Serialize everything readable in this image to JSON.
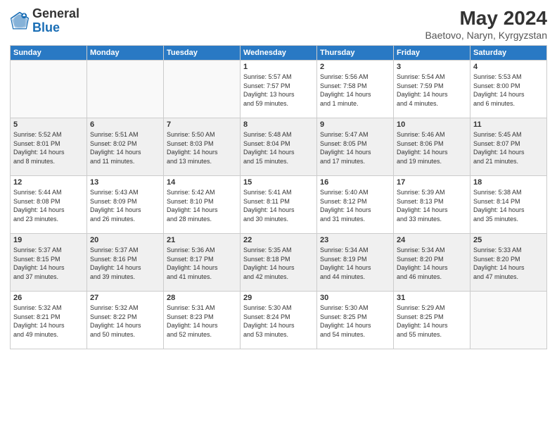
{
  "logo": {
    "text_general": "General",
    "text_blue": "Blue"
  },
  "header": {
    "month": "May 2024",
    "location": "Baetovo, Naryn, Kyrgyzstan"
  },
  "weekdays": [
    "Sunday",
    "Monday",
    "Tuesday",
    "Wednesday",
    "Thursday",
    "Friday",
    "Saturday"
  ],
  "weeks": [
    {
      "shaded": false,
      "days": [
        {
          "num": "",
          "info": ""
        },
        {
          "num": "",
          "info": ""
        },
        {
          "num": "",
          "info": ""
        },
        {
          "num": "1",
          "info": "Sunrise: 5:57 AM\nSunset: 7:57 PM\nDaylight: 13 hours\nand 59 minutes."
        },
        {
          "num": "2",
          "info": "Sunrise: 5:56 AM\nSunset: 7:58 PM\nDaylight: 14 hours\nand 1 minute."
        },
        {
          "num": "3",
          "info": "Sunrise: 5:54 AM\nSunset: 7:59 PM\nDaylight: 14 hours\nand 4 minutes."
        },
        {
          "num": "4",
          "info": "Sunrise: 5:53 AM\nSunset: 8:00 PM\nDaylight: 14 hours\nand 6 minutes."
        }
      ]
    },
    {
      "shaded": true,
      "days": [
        {
          "num": "5",
          "info": "Sunrise: 5:52 AM\nSunset: 8:01 PM\nDaylight: 14 hours\nand 8 minutes."
        },
        {
          "num": "6",
          "info": "Sunrise: 5:51 AM\nSunset: 8:02 PM\nDaylight: 14 hours\nand 11 minutes."
        },
        {
          "num": "7",
          "info": "Sunrise: 5:50 AM\nSunset: 8:03 PM\nDaylight: 14 hours\nand 13 minutes."
        },
        {
          "num": "8",
          "info": "Sunrise: 5:48 AM\nSunset: 8:04 PM\nDaylight: 14 hours\nand 15 minutes."
        },
        {
          "num": "9",
          "info": "Sunrise: 5:47 AM\nSunset: 8:05 PM\nDaylight: 14 hours\nand 17 minutes."
        },
        {
          "num": "10",
          "info": "Sunrise: 5:46 AM\nSunset: 8:06 PM\nDaylight: 14 hours\nand 19 minutes."
        },
        {
          "num": "11",
          "info": "Sunrise: 5:45 AM\nSunset: 8:07 PM\nDaylight: 14 hours\nand 21 minutes."
        }
      ]
    },
    {
      "shaded": false,
      "days": [
        {
          "num": "12",
          "info": "Sunrise: 5:44 AM\nSunset: 8:08 PM\nDaylight: 14 hours\nand 23 minutes."
        },
        {
          "num": "13",
          "info": "Sunrise: 5:43 AM\nSunset: 8:09 PM\nDaylight: 14 hours\nand 26 minutes."
        },
        {
          "num": "14",
          "info": "Sunrise: 5:42 AM\nSunset: 8:10 PM\nDaylight: 14 hours\nand 28 minutes."
        },
        {
          "num": "15",
          "info": "Sunrise: 5:41 AM\nSunset: 8:11 PM\nDaylight: 14 hours\nand 30 minutes."
        },
        {
          "num": "16",
          "info": "Sunrise: 5:40 AM\nSunset: 8:12 PM\nDaylight: 14 hours\nand 31 minutes."
        },
        {
          "num": "17",
          "info": "Sunrise: 5:39 AM\nSunset: 8:13 PM\nDaylight: 14 hours\nand 33 minutes."
        },
        {
          "num": "18",
          "info": "Sunrise: 5:38 AM\nSunset: 8:14 PM\nDaylight: 14 hours\nand 35 minutes."
        }
      ]
    },
    {
      "shaded": true,
      "days": [
        {
          "num": "19",
          "info": "Sunrise: 5:37 AM\nSunset: 8:15 PM\nDaylight: 14 hours\nand 37 minutes."
        },
        {
          "num": "20",
          "info": "Sunrise: 5:37 AM\nSunset: 8:16 PM\nDaylight: 14 hours\nand 39 minutes."
        },
        {
          "num": "21",
          "info": "Sunrise: 5:36 AM\nSunset: 8:17 PM\nDaylight: 14 hours\nand 41 minutes."
        },
        {
          "num": "22",
          "info": "Sunrise: 5:35 AM\nSunset: 8:18 PM\nDaylight: 14 hours\nand 42 minutes."
        },
        {
          "num": "23",
          "info": "Sunrise: 5:34 AM\nSunset: 8:19 PM\nDaylight: 14 hours\nand 44 minutes."
        },
        {
          "num": "24",
          "info": "Sunrise: 5:34 AM\nSunset: 8:20 PM\nDaylight: 14 hours\nand 46 minutes."
        },
        {
          "num": "25",
          "info": "Sunrise: 5:33 AM\nSunset: 8:20 PM\nDaylight: 14 hours\nand 47 minutes."
        }
      ]
    },
    {
      "shaded": false,
      "days": [
        {
          "num": "26",
          "info": "Sunrise: 5:32 AM\nSunset: 8:21 PM\nDaylight: 14 hours\nand 49 minutes."
        },
        {
          "num": "27",
          "info": "Sunrise: 5:32 AM\nSunset: 8:22 PM\nDaylight: 14 hours\nand 50 minutes."
        },
        {
          "num": "28",
          "info": "Sunrise: 5:31 AM\nSunset: 8:23 PM\nDaylight: 14 hours\nand 52 minutes."
        },
        {
          "num": "29",
          "info": "Sunrise: 5:30 AM\nSunset: 8:24 PM\nDaylight: 14 hours\nand 53 minutes."
        },
        {
          "num": "30",
          "info": "Sunrise: 5:30 AM\nSunset: 8:25 PM\nDaylight: 14 hours\nand 54 minutes."
        },
        {
          "num": "31",
          "info": "Sunrise: 5:29 AM\nSunset: 8:25 PM\nDaylight: 14 hours\nand 55 minutes."
        },
        {
          "num": "",
          "info": ""
        }
      ]
    }
  ]
}
